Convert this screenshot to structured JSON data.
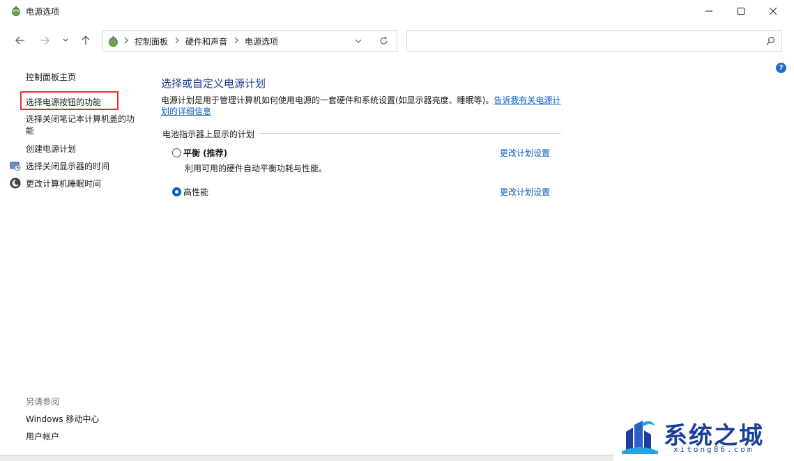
{
  "window": {
    "title": "电源选项"
  },
  "nav": {
    "breadcrumbs": [
      "控制面板",
      "硬件和声音",
      "电源选项"
    ],
    "search_placeholder": ""
  },
  "left_pane": {
    "home": "控制面板主页",
    "links": [
      "选择电源按钮的功能",
      "选择关闭笔记本计算机盖的功能",
      "创建电源计划",
      "选择关闭显示器的时间",
      "更改计算机睡眠时间"
    ],
    "see_also_label": "另请参阅",
    "see_also_links": [
      "Windows 移动中心",
      "用户帐户"
    ]
  },
  "main": {
    "title": "选择或自定义电源计划",
    "description": "电源计划是用于管理计算机如何使用电源的一套硬件和系统设置(如显示器亮度、睡眠等)。",
    "description_link": "告诉我有关电源计划的详细信息",
    "section_label": "电池指示器上显示的计划",
    "plans": [
      {
        "name": "平衡 (推荐)",
        "description": "利用可用的硬件自动平衡功耗与性能。",
        "selected": false,
        "link": "更改计划设置"
      },
      {
        "name": "高性能",
        "description": "",
        "selected": true,
        "link": "更改计划设置"
      }
    ],
    "help": "?"
  },
  "watermark": {
    "text": "系统之城",
    "sub": "xitong86.com"
  },
  "colors": {
    "accent": "#0a5cc2",
    "title_blue": "#1c3e8e",
    "highlight": "#e0312e"
  }
}
